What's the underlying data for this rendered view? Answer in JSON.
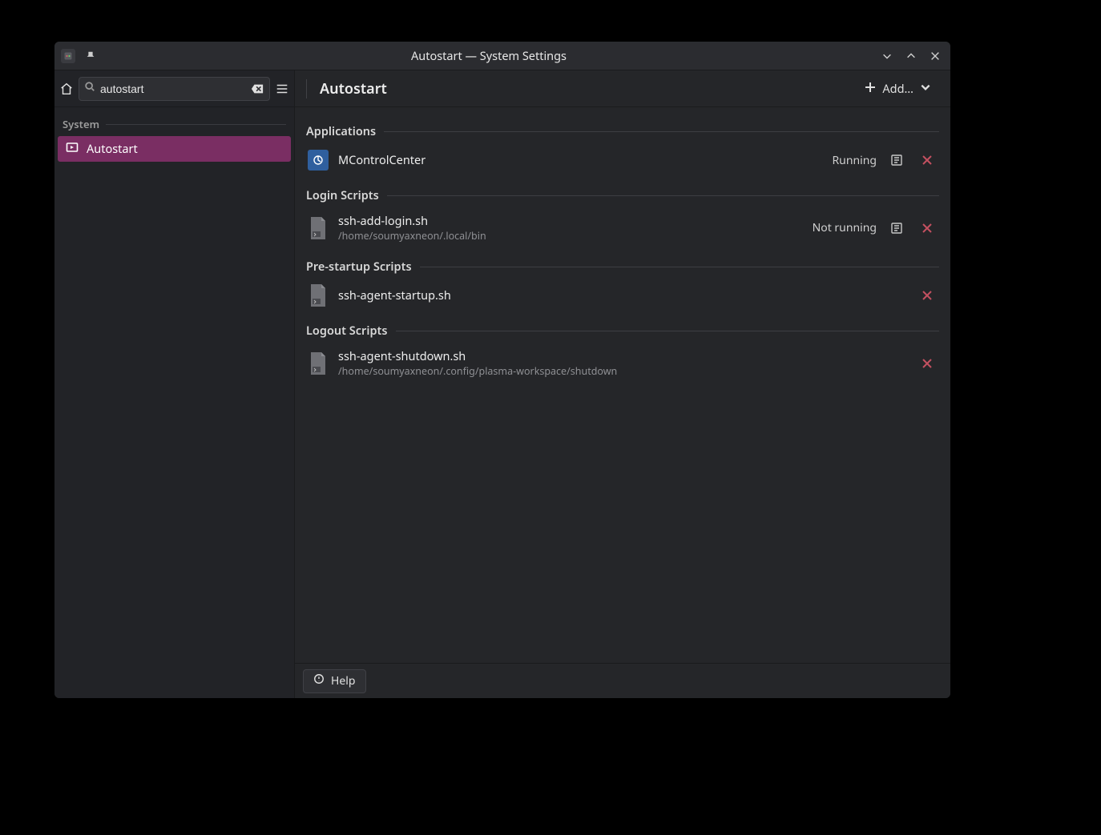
{
  "window": {
    "title": "Autostart — System Settings"
  },
  "sidebar": {
    "search_value": "autostart",
    "group_label": "System",
    "item_label": "Autostart"
  },
  "header": {
    "page_title": "Autostart",
    "add_label": "Add…"
  },
  "sections": {
    "applications": {
      "label": "Applications",
      "items": [
        {
          "name": "MControlCenter",
          "status": "Running"
        }
      ]
    },
    "login_scripts": {
      "label": "Login Scripts",
      "items": [
        {
          "name": "ssh-add-login.sh",
          "path": "/home/soumyaxneon/.local/bin",
          "status": "Not running"
        }
      ]
    },
    "prestartup_scripts": {
      "label": "Pre-startup Scripts",
      "items": [
        {
          "name": "ssh-agent-startup.sh"
        }
      ]
    },
    "logout_scripts": {
      "label": "Logout Scripts",
      "items": [
        {
          "name": "ssh-agent-shutdown.sh",
          "path": "/home/soumyaxneon/.config/plasma-workspace/shutdown"
        }
      ]
    }
  },
  "footer": {
    "help_label": "Help"
  }
}
